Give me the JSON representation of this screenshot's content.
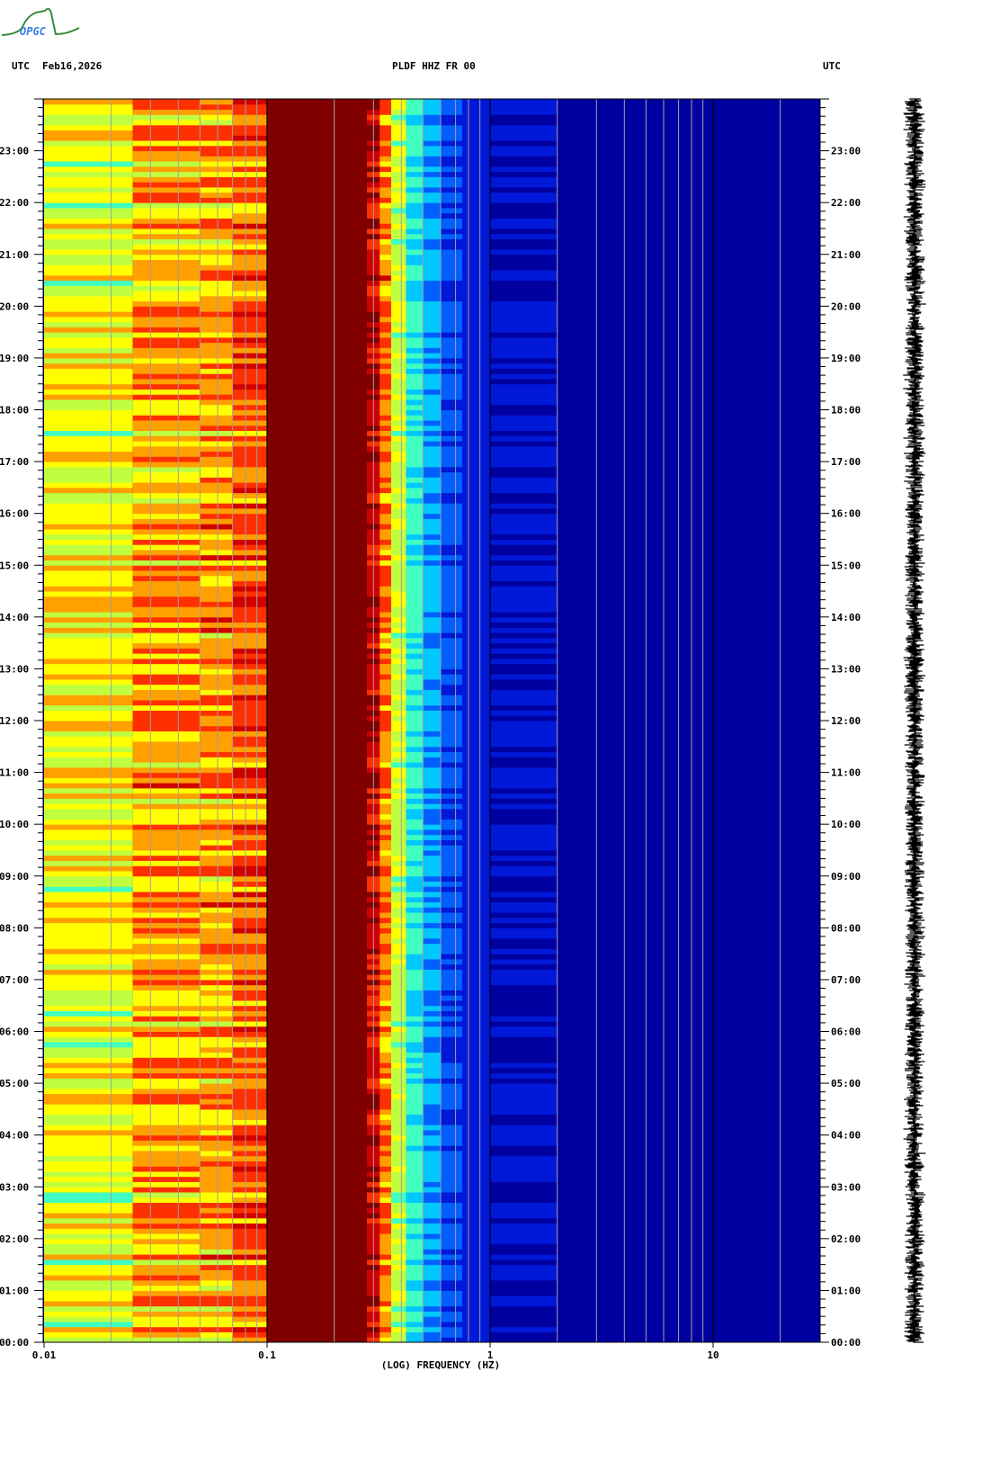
{
  "header": {
    "logo_text": "OPGC",
    "left_label": "UTC",
    "date": "Feb16,2026",
    "station": "PLDF HHZ FR 00",
    "right_label": "UTC"
  },
  "chart_data": {
    "type": "heatmap",
    "title": "PLDF HHZ FR 00",
    "xlabel": "(LOG) FREQUENCY (HZ)",
    "xscale": "log",
    "xlim": [
      0.01,
      30
    ],
    "x_ticks": [
      "0.01",
      "0.1",
      "1",
      "10"
    ],
    "x_tick_values": [
      0.01,
      0.1,
      1,
      10
    ],
    "ylim_hours": [
      0,
      24
    ],
    "y_ticks": [
      "00:00",
      "01:00",
      "02:00",
      "03:00",
      "04:00",
      "05:00",
      "06:00",
      "07:00",
      "08:00",
      "09:00",
      "10:00",
      "11:00",
      "12:00",
      "13:00",
      "14:00",
      "15:00",
      "16:00",
      "17:00",
      "18:00",
      "19:00",
      "20:00",
      "21:00",
      "22:00",
      "23:00"
    ],
    "colormap": [
      "#0000a0",
      "#0018d8",
      "#0060ff",
      "#00c8ff",
      "#40ffc0",
      "#c0ff40",
      "#ffff00",
      "#ffa000",
      "#ff3000",
      "#d00000",
      "#800000"
    ],
    "bands": [
      {
        "f0": 0.01,
        "f1": 0.025,
        "level": 0.58,
        "spread": 0.12
      },
      {
        "f0": 0.025,
        "f1": 0.05,
        "level": 0.68,
        "spread": 0.14
      },
      {
        "f0": 0.05,
        "f1": 0.07,
        "level": 0.68,
        "spread": 0.14
      },
      {
        "f0": 0.07,
        "f1": 0.1,
        "level": 0.76,
        "spread": 0.12
      },
      {
        "f0": 0.1,
        "f1": 0.28,
        "level": 1.0,
        "spread": 0.0
      },
      {
        "f0": 0.28,
        "f1": 0.32,
        "level": 0.9,
        "spread": 0.1
      },
      {
        "f0": 0.32,
        "f1": 0.36,
        "level": 0.72,
        "spread": 0.1
      },
      {
        "f0": 0.36,
        "f1": 0.42,
        "level": 0.52,
        "spread": 0.08
      },
      {
        "f0": 0.42,
        "f1": 0.5,
        "level": 0.36,
        "spread": 0.06
      },
      {
        "f0": 0.5,
        "f1": 0.6,
        "level": 0.26,
        "spread": 0.05
      },
      {
        "f0": 0.6,
        "f1": 0.75,
        "level": 0.16,
        "spread": 0.04
      },
      {
        "f0": 0.75,
        "f1": 1.0,
        "level": 0.1,
        "spread": 0.03
      },
      {
        "f0": 1.0,
        "f1": 2.0,
        "level": 0.05,
        "spread": 0.02
      },
      {
        "f0": 2.0,
        "f1": 30,
        "level": 0.01,
        "spread": 0.01
      }
    ],
    "grid_minor_freqs": [
      0.02,
      0.03,
      0.04,
      0.05,
      0.06,
      0.07,
      0.08,
      0.09,
      0.2,
      0.3,
      0.4,
      0.5,
      0.6,
      0.7,
      0.8,
      0.9,
      2,
      3,
      4,
      5,
      6,
      7,
      8,
      9,
      20
    ],
    "grid_major_freqs": [
      0.1,
      1,
      10
    ],
    "seismogram": "trace"
  }
}
